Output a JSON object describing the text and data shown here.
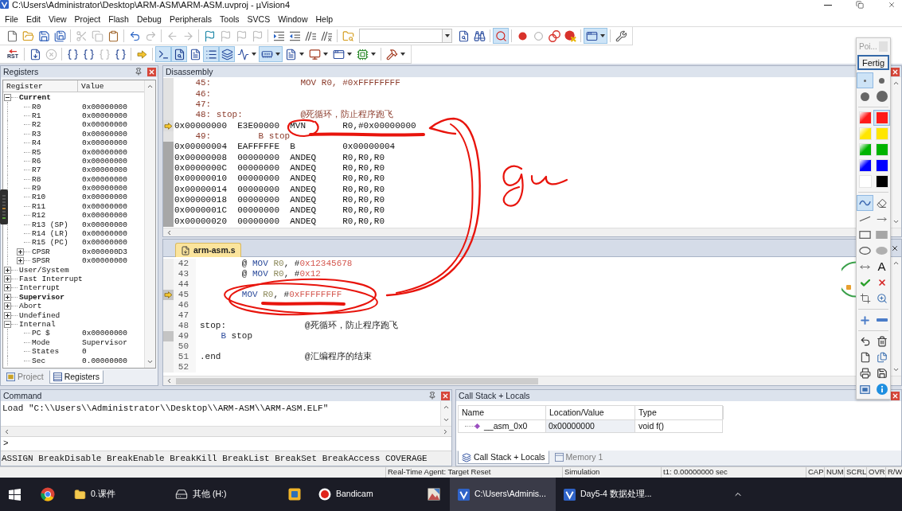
{
  "window": {
    "title": "C:\\Users\\Administrator\\Desktop\\ARM-ASM\\ARM-ASM.uvproj - µVision4"
  },
  "menu": [
    "File",
    "Edit",
    "View",
    "Project",
    "Flash",
    "Debug",
    "Peripherals",
    "Tools",
    "SVCS",
    "Window",
    "Help"
  ],
  "toolbars": [
    {
      "groups": [
        [
          {
            "kind": "new-file",
            "disabled": false,
            "on": false
          },
          {
            "kind": "open",
            "disabled": false,
            "on": false
          },
          {
            "kind": "save",
            "disabled": false,
            "on": false
          },
          {
            "kind": "save-all",
            "disabled": false,
            "on": false
          }
        ],
        [
          {
            "kind": "cut",
            "disabled": true,
            "on": false
          },
          {
            "kind": "copy",
            "disabled": true,
            "on": false
          },
          {
            "kind": "paste",
            "disabled": false,
            "on": false
          }
        ],
        [
          {
            "kind": "undo",
            "disabled": false,
            "on": false
          },
          {
            "kind": "redo",
            "disabled": true,
            "on": false
          }
        ],
        [
          {
            "kind": "back",
            "disabled": true,
            "on": false
          },
          {
            "kind": "forward",
            "disabled": true,
            "on": false
          }
        ],
        [
          {
            "kind": "bookmark",
            "disabled": false,
            "on": false
          },
          {
            "kind": "previous-bookmark",
            "disabled": true,
            "on": false
          },
          {
            "kind": "next-bookmark",
            "disabled": true,
            "on": false
          },
          {
            "kind": "clear-bookmarks",
            "disabled": true,
            "on": false
          }
        ],
        [
          {
            "kind": "indent",
            "disabled": false,
            "on": false
          },
          {
            "kind": "unindent",
            "disabled": false,
            "on": false
          },
          {
            "kind": "comment",
            "disabled": false,
            "on": false
          },
          {
            "kind": "uncomment",
            "disabled": false,
            "on": false
          }
        ],
        [
          {
            "kind": "find-in-files",
            "disabled": false,
            "on": false
          },
          {
            "kind": "find-combo",
            "disabled": false,
            "on": false,
            "dropdown": true
          },
          {
            "kind": "find",
            "disabled": false,
            "on": false
          },
          {
            "kind": "incremental-find",
            "disabled": false,
            "on": false
          }
        ],
        [
          {
            "kind": "debug",
            "disabled": false,
            "on": true
          }
        ],
        [
          {
            "kind": "breakpoint",
            "disabled": false,
            "on": false
          },
          {
            "kind": "disable-breakpoint",
            "disabled": false,
            "on": false
          },
          {
            "kind": "disable-all-breakpoints",
            "disabled": false,
            "on": false
          },
          {
            "kind": "kill-all-breakpoints",
            "disabled": false,
            "on": false
          }
        ],
        [
          {
            "kind": "window-layout",
            "disabled": false,
            "on": true,
            "dropdown": true
          }
        ],
        [
          {
            "kind": "configure",
            "disabled": false,
            "on": false
          }
        ]
      ]
    },
    {
      "groups": [
        [
          {
            "kind": "reset",
            "label": "RST",
            "disabled": false,
            "on": false
          }
        ],
        [
          {
            "kind": "run",
            "disabled": false,
            "on": false
          },
          {
            "kind": "stop",
            "disabled": true,
            "on": false
          }
        ],
        [
          {
            "kind": "step",
            "disabled": false,
            "on": false
          },
          {
            "kind": "step-over",
            "disabled": false,
            "on": false
          },
          {
            "kind": "step-out",
            "disabled": true,
            "on": false
          },
          {
            "kind": "run-to-cursor",
            "disabled": false,
            "on": false
          }
        ],
        [
          {
            "kind": "next-statement",
            "disabled": false,
            "on": false
          }
        ],
        [
          {
            "kind": "command-window",
            "disabled": false,
            "on": true
          },
          {
            "kind": "disassembly-window",
            "disabled": false,
            "on": true
          },
          {
            "kind": "symbols-window",
            "disabled": false,
            "on": false
          },
          {
            "kind": "registers-window",
            "disabled": false,
            "on": true
          },
          {
            "kind": "call-stack-window",
            "disabled": false,
            "on": true
          },
          {
            "kind": "watch-window",
            "disabled": false,
            "on": false,
            "dropdown": true
          },
          {
            "kind": "memory-window",
            "disabled": false,
            "on": true,
            "dropdown": true
          },
          {
            "kind": "serial-window",
            "disabled": false,
            "on": false,
            "dropdown": true
          },
          {
            "kind": "analysis-window",
            "disabled": false,
            "on": false,
            "dropdown": true
          },
          {
            "kind": "trace-window",
            "disabled": false,
            "on": false,
            "dropdown": true
          },
          {
            "kind": "system-viewer",
            "disabled": false,
            "on": false,
            "dropdown": true
          }
        ],
        [
          {
            "kind": "toolbox",
            "disabled": false,
            "on": false,
            "dropdown": true
          }
        ]
      ]
    }
  ],
  "registers": {
    "title": "Registers",
    "columns": [
      "Register",
      "Value"
    ],
    "tree": [
      {
        "label": "Current",
        "active": true,
        "expanded": true,
        "children": [
          {
            "label": "R0",
            "value": "0x00000000"
          },
          {
            "label": "R1",
            "value": "0x00000000"
          },
          {
            "label": "R2",
            "value": "0x00000000"
          },
          {
            "label": "R3",
            "value": "0x00000000"
          },
          {
            "label": "R4",
            "value": "0x00000000"
          },
          {
            "label": "R5",
            "value": "0x00000000"
          },
          {
            "label": "R6",
            "value": "0x00000000"
          },
          {
            "label": "R7",
            "value": "0x00000000"
          },
          {
            "label": "R8",
            "value": "0x00000000"
          },
          {
            "label": "R9",
            "value": "0x00000000"
          },
          {
            "label": "R10",
            "value": "0x00000000"
          },
          {
            "label": "R11",
            "value": "0x00000000"
          },
          {
            "label": "R12",
            "value": "0x00000000"
          },
          {
            "label": "R13 (SP)",
            "value": "0x00000000"
          },
          {
            "label": "R14 (LR)",
            "value": "0x00000000"
          },
          {
            "label": "R15 (PC)",
            "value": "0x00000000"
          },
          {
            "label": "CPSR",
            "value": "0x000000D3",
            "expanded": false
          },
          {
            "label": "SPSR",
            "value": "0x00000000",
            "expanded": false
          }
        ]
      },
      {
        "label": "User/System",
        "active": false,
        "expanded": false
      },
      {
        "label": "Fast Interrupt",
        "active": false,
        "expanded": false
      },
      {
        "label": "Interrupt",
        "active": false,
        "expanded": false
      },
      {
        "label": "Supervisor",
        "active": true,
        "expanded": false
      },
      {
        "label": "Abort",
        "active": false,
        "expanded": false
      },
      {
        "label": "Undefined",
        "active": false,
        "expanded": false
      },
      {
        "label": "Internal",
        "active": false,
        "expanded": true,
        "children": [
          {
            "label": "PC $",
            "value": "0x00000000"
          },
          {
            "label": "Mode",
            "value": "Supervisor"
          },
          {
            "label": "States",
            "value": "0"
          },
          {
            "label": "Sec",
            "value": "0.00000000"
          }
        ]
      }
    ],
    "tabs": [
      {
        "label": "Project",
        "selected": false
      },
      {
        "label": "Registers",
        "selected": true
      }
    ]
  },
  "disassembly": {
    "title": "Disassembly",
    "rows": [
      {
        "kind": "source",
        "line": "45:",
        "text": "\t\t\t\tMOV R0, #0xFFFFFFFF",
        "current": false
      },
      {
        "kind": "source",
        "line": "46:",
        "current": false
      },
      {
        "kind": "source",
        "line": "47:",
        "current": false
      },
      {
        "kind": "source",
        "line": "48:",
        "text": "stop:\t\t\t@死循环，防止程序跑飞",
        "current": false
      },
      {
        "kind": "instruction",
        "address": "0x00000000",
        "opcode": "E3E00000",
        "mnemonic": "MVN",
        "operands": "R0,#0x00000000",
        "current": true
      },
      {
        "kind": "source",
        "line": "49:",
        "text": "\t\tB stop",
        "current": false
      },
      {
        "kind": "instruction",
        "address": "0x00000004",
        "opcode": "EAFFFFFE",
        "mnemonic": "B",
        "operands": "0x00000004",
        "current": false
      },
      {
        "kind": "instruction",
        "address": "0x00000008",
        "opcode": "00000000",
        "mnemonic": "ANDEQ",
        "operands": "R0,R0,R0",
        "current": false
      },
      {
        "kind": "instruction",
        "address": "0x0000000C",
        "opcode": "00000000",
        "mnemonic": "ANDEQ",
        "operands": "R0,R0,R0",
        "current": false
      },
      {
        "kind": "instruction",
        "address": "0x00000010",
        "opcode": "00000000",
        "mnemonic": "ANDEQ",
        "operands": "R0,R0,R0",
        "current": false
      },
      {
        "kind": "instruction",
        "address": "0x00000014",
        "opcode": "00000000",
        "mnemonic": "ANDEQ",
        "operands": "R0,R0,R0",
        "current": false
      },
      {
        "kind": "instruction",
        "address": "0x00000018",
        "opcode": "00000000",
        "mnemonic": "ANDEQ",
        "operands": "R0,R0,R0",
        "current": false
      },
      {
        "kind": "instruction",
        "address": "0x0000001C",
        "opcode": "00000000",
        "mnemonic": "ANDEQ",
        "operands": "R0,R0,R0",
        "current": false
      },
      {
        "kind": "instruction",
        "address": "0x00000020",
        "opcode": "00000000",
        "mnemonic": "ANDEQ",
        "operands": "R0,R0,R0",
        "current": false
      }
    ]
  },
  "editor": {
    "tabs": [
      {
        "label": "arm-asm.s",
        "selected": true
      }
    ],
    "lines": [
      {
        "number": "42",
        "segments": [
          {
            "kind": "plain",
            "text": "\t\t@ "
          },
          {
            "kind": "keyword",
            "text": "MOV "
          },
          {
            "kind": "register",
            "text": "R0"
          },
          {
            "kind": "plain",
            "text": ", #"
          },
          {
            "kind": "number",
            "text": "0x12345678"
          }
        ],
        "current": false,
        "executable": false
      },
      {
        "number": "43",
        "segments": [
          {
            "kind": "plain",
            "text": "\t\t@ "
          },
          {
            "kind": "keyword",
            "text": "MOV "
          },
          {
            "kind": "register",
            "text": "R0"
          },
          {
            "kind": "plain",
            "text": ", #"
          },
          {
            "kind": "number",
            "text": "0x12"
          }
        ],
        "current": false,
        "executable": false
      },
      {
        "number": "44",
        "current": false,
        "executable": false
      },
      {
        "number": "45",
        "segments": [
          {
            "kind": "keyword",
            "text": "\t\tMOV "
          },
          {
            "kind": "register",
            "text": "R0"
          },
          {
            "kind": "plain",
            "text": ", #"
          },
          {
            "kind": "number",
            "text": "0xFFFFFFFF"
          }
        ],
        "current": true,
        "executable": true
      },
      {
        "number": "46",
        "current": false,
        "executable": false
      },
      {
        "number": "47",
        "current": false,
        "executable": false
      },
      {
        "number": "48",
        "segments": [
          {
            "kind": "plain",
            "text": "stop:\t\t\t\t@死循环，防止程序跑飞"
          }
        ],
        "current": false,
        "executable": false
      },
      {
        "number": "49",
        "segments": [
          {
            "kind": "keyword",
            "text": "\tB"
          },
          {
            "kind": "plain",
            "text": " stop"
          }
        ],
        "current": false,
        "executable": true
      },
      {
        "number": "50",
        "current": false,
        "executable": false
      },
      {
        "number": "51",
        "segments": [
          {
            "kind": "plain",
            "text": ".end\t\t\t\t@汇编程序的结束"
          }
        ],
        "current": false,
        "executable": false
      },
      {
        "number": "52",
        "current": false,
        "executable": false
      }
    ]
  },
  "command": {
    "title": "Command",
    "output": [
      "Load \"C:\\\\Users\\\\Administrator\\\\Desktop\\\\ARM-ASM\\\\ARM-ASM.ELF\""
    ],
    "prompt": ">",
    "commands": "ASSIGN BreakDisable BreakEnable BreakKill BreakList BreakSet BreakAccess COVERAGE"
  },
  "call_stack": {
    "title": "Call Stack + Locals",
    "columns": [
      "Name",
      "Location/Value",
      "Type"
    ],
    "rows": [
      {
        "name": "__asm_0x0",
        "value": "0x00000000",
        "type": "void f()"
      }
    ],
    "tabs": [
      {
        "label": "Call Stack + Locals",
        "selected": true
      },
      {
        "label": "Memory 1",
        "selected": false
      }
    ]
  },
  "status_bar": [
    "Real-Time Agent: Target Reset",
    "Simulation",
    "t1: 0.00000000 sec",
    "CAP",
    "NUM",
    "SCRL",
    "OVR",
    "R/W"
  ],
  "taskbar": [
    {
      "kind": "start",
      "active": false
    },
    {
      "kind": "browser",
      "active": false
    },
    {
      "kind": "folder",
      "label": "0.课件",
      "active": false
    },
    {
      "kind": "drive",
      "label": "其他 (H:)",
      "active": false
    },
    {
      "kind": "app",
      "active": false
    },
    {
      "kind": "recorder",
      "label": "Bandicam",
      "active": false
    },
    {
      "kind": "image-viewer",
      "active": false
    },
    {
      "kind": "uvision",
      "label": "C:\\Users\\Adminis...",
      "active": true
    },
    {
      "kind": "uvision",
      "label": "Day5-4 数据处理...",
      "active": false
    }
  ],
  "pen_toolbar": {
    "title": "Poi...",
    "button": "Fertig",
    "sizes": [
      {
        "selected": true
      },
      {
        "selected": false
      },
      {
        "selected": false
      },
      {
        "selected": false
      }
    ],
    "colors": [
      {
        "kind": "gradient",
        "color": "#ff1a1a",
        "selected": false
      },
      {
        "kind": "solid",
        "color": "#ff1a1a",
        "selected": true
      },
      {
        "kind": "gradient",
        "color": "#ffe600",
        "selected": false
      },
      {
        "kind": "solid",
        "color": "#ffe600",
        "selected": false
      },
      {
        "kind": "gradient",
        "color": "#00b400",
        "selected": false
      },
      {
        "kind": "solid",
        "color": "#00b400",
        "selected": false
      },
      {
        "kind": "gradient",
        "color": "#0000ff",
        "selected": false
      },
      {
        "kind": "solid",
        "color": "#0000ff",
        "selected": false
      },
      {
        "kind": "solid",
        "color": "#ffffff",
        "selected": false
      },
      {
        "kind": "solid",
        "color": "#000000",
        "selected": false
      }
    ],
    "tool_groups": [
      [
        {
          "kind": "pen",
          "selected": true
        },
        {
          "kind": "eraser",
          "selected": false
        },
        {
          "kind": "line",
          "selected": false
        },
        {
          "kind": "arrow",
          "selected": false
        },
        {
          "kind": "rectangle",
          "selected": false
        },
        {
          "kind": "filled-rectangle",
          "selected": false
        },
        {
          "kind": "ellipse",
          "selected": false
        },
        {
          "kind": "filled-ellipse",
          "selected": false
        },
        {
          "kind": "double-arrow",
          "selected": false
        },
        {
          "kind": "text",
          "label": "A",
          "selected": false
        },
        {
          "kind": "check",
          "selected": false
        },
        {
          "kind": "cross",
          "selected": false
        },
        {
          "kind": "crop",
          "selected": false
        },
        {
          "kind": "zoom",
          "selected": false
        }
      ],
      [
        {
          "kind": "plus",
          "selected": false
        },
        {
          "kind": "minus",
          "selected": false
        }
      ],
      [
        {
          "kind": "undo",
          "selected": false
        },
        {
          "kind": "trash",
          "selected": false
        },
        {
          "kind": "new-page",
          "selected": false
        },
        {
          "kind": "copy-page",
          "selected": false
        },
        {
          "kind": "print",
          "selected": false
        },
        {
          "kind": "save",
          "selected": false
        },
        {
          "kind": "screen",
          "selected": false
        },
        {
          "kind": "info",
          "selected": false
        }
      ]
    ]
  }
}
